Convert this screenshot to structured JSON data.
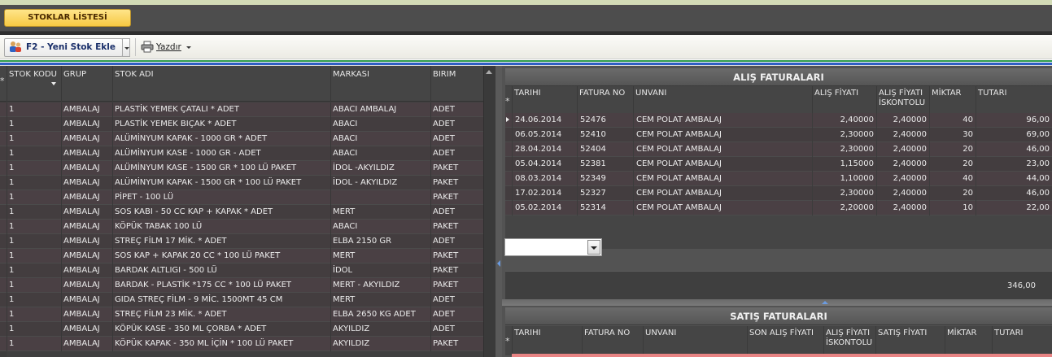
{
  "header": {
    "title_tab": "STOKLAR LİSTESİ"
  },
  "toolbar": {
    "add_label": "F2 - Yeni Stok Ekle",
    "print_label": "Yazdır"
  },
  "stock_table": {
    "columns": [
      "STOK KODU",
      "GRUP",
      "STOK ADI",
      "MARKASI",
      "BIRIM"
    ],
    "rows": [
      [
        "1",
        "AMBALAJ",
        "PLASTİK YEMEK ÇATALI * ADET",
        "ABACI AMBALAJ",
        "ADET"
      ],
      [
        "1",
        "AMBALAJ",
        "PLASTİK YEMEK BIÇAK * ADET",
        "ABACI",
        "ADET"
      ],
      [
        "1",
        "AMBALAJ",
        "ALÜMİNYUM KAPAK - 1000 GR * ADET",
        "ABACI",
        "ADET"
      ],
      [
        "1",
        "AMBALAJ",
        "ALÜMİNYUM KASE - 1000 GR - ADET",
        "ABACI",
        "ADET"
      ],
      [
        "1",
        "AMBALAJ",
        "ALÜMİNYUM KASE - 1500 GR * 100 LÜ PAKET",
        "İDOL -AKYILDIZ",
        "PAKET"
      ],
      [
        "1",
        "AMBALAJ",
        "ALÜMİNYUM KAPAK - 1500 GR *  100 LÜ PAKET",
        "İDOL - AKYILDIZ",
        "PAKET"
      ],
      [
        "1",
        "AMBALAJ",
        "PİPET - 100 LÜ",
        "",
        "PAKET"
      ],
      [
        "1",
        "AMBALAJ",
        "SOS KABI - 50 CC KAP + KAPAK * ADET",
        "MERT",
        "ADET"
      ],
      [
        "1",
        "AMBALAJ",
        "KÖPÜK TABAK 100 LÜ",
        "ABACI",
        "PAKET"
      ],
      [
        "1",
        "AMBALAJ",
        "STREÇ FİLM 17 MİK. * ADET",
        "ELBA 2150 GR",
        "ADET"
      ],
      [
        "1",
        "AMBALAJ",
        "SOS KAP + KAPAK 20 CC * 100 LÜ PAKET",
        "MERT",
        "PAKET"
      ],
      [
        "1",
        "AMBALAJ",
        "BARDAK ALTLIGI - 500 LÜ",
        "İDOL",
        "PAKET"
      ],
      [
        "1",
        "AMBALAJ",
        "BARDAK - PLASTİK *175 CC * 100 LÜ PAKET",
        "MERT - AKYILDIZ",
        "PAKET"
      ],
      [
        "1",
        "AMBALAJ",
        "GIDA STREÇ FİLM  - 9 MİC. 1500MT 45 CM",
        "MERT",
        "ADET"
      ],
      [
        "1",
        "AMBALAJ",
        "STREÇ FİLM 23 MİK. * ADET",
        "ELBA 2650 KG ADET",
        "ADET"
      ],
      [
        "1",
        "AMBALAJ",
        "KÖPÜK KASE - 350 ML ÇORBA * ADET",
        "AKYILDIZ",
        "ADET"
      ],
      [
        "1",
        "AMBALAJ",
        "KÖPÜK KAPAK - 350 ML İÇİN * 100 LÜ PAKET",
        "AKYILDIZ",
        "PAKET"
      ]
    ]
  },
  "alis": {
    "title": "ALIŞ FATURALARI",
    "columns": [
      "TARIHI",
      "FATURA NO",
      "UNVANI",
      "ALIŞ FİYATI",
      "ALIŞ FİYATI İSKONTOLU",
      "MİKTAR",
      "TUTARI"
    ],
    "rows": [
      [
        "24.06.2014",
        "52476",
        "CEM POLAT AMBALAJ",
        "2,40000",
        "2,40000",
        "40",
        "96,00"
      ],
      [
        "06.05.2014",
        "52410",
        "CEM POLAT AMBALAJ",
        "2,30000",
        "2,40000",
        "30",
        "69,00"
      ],
      [
        "28.04.2014",
        "52404",
        "CEM POLAT AMBALAJ",
        "2,30000",
        "2,40000",
        "20",
        "46,00"
      ],
      [
        "05.04.2014",
        "52381",
        "CEM POLAT AMBALAJ",
        "1,15000",
        "2,40000",
        "20",
        "23,00"
      ],
      [
        "08.03.2014",
        "52349",
        "CEM POLAT AMBALAJ",
        "1,10000",
        "2,40000",
        "40",
        "44,00"
      ],
      [
        "17.02.2014",
        "52327",
        "CEM POLAT AMBALAJ",
        "2,30000",
        "2,40000",
        "20",
        "46,00"
      ],
      [
        "05.02.2014",
        "52314",
        "CEM POLAT AMBALAJ",
        "2,20000",
        "2,40000",
        "10",
        "22,00"
      ]
    ],
    "total": "346,00",
    "filter_value": ""
  },
  "satis": {
    "title": "SATIŞ  FATURALARI",
    "columns": [
      "TARIHI",
      "FATURA NO",
      "UNVANI",
      "SON ALIŞ FİYATI",
      "ALIŞ FİYATI İSKONTOLU",
      "SATIŞ FİYATI",
      "MİKTAR",
      "TUTARI"
    ]
  },
  "colors": {
    "accent": "#f6c843",
    "selected_row": "#e88484",
    "stripe_green": "#2d9a4c",
    "stripe_blue": "#2f5fc4"
  }
}
